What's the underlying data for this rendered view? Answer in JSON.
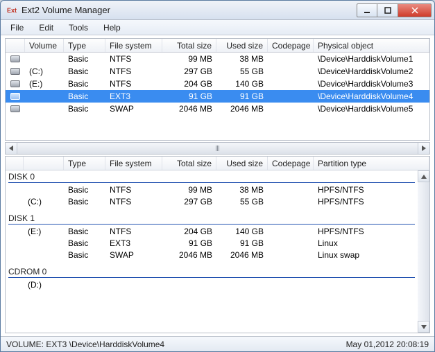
{
  "window": {
    "title": "Ext2 Volume Manager",
    "icon_label": "Ext"
  },
  "menu": {
    "file": "File",
    "edit": "Edit",
    "tools": "Tools",
    "help": "Help"
  },
  "columns_top": {
    "volume": "Volume",
    "type": "Type",
    "fs": "File system",
    "total": "Total size",
    "used": "Used size",
    "codepage": "Codepage",
    "physical": "Physical object"
  },
  "volumes": [
    {
      "vol": "",
      "type": "Basic",
      "fs": "NTFS",
      "total": "99 MB",
      "used": "38 MB",
      "cp": "",
      "phys": "\\Device\\HarddiskVolume1",
      "sel": false
    },
    {
      "vol": "(C:)",
      "type": "Basic",
      "fs": "NTFS",
      "total": "297 GB",
      "used": "55 GB",
      "cp": "",
      "phys": "\\Device\\HarddiskVolume2",
      "sel": false
    },
    {
      "vol": "(E:)",
      "type": "Basic",
      "fs": "NTFS",
      "total": "204 GB",
      "used": "140 GB",
      "cp": "",
      "phys": "\\Device\\HarddiskVolume3",
      "sel": false
    },
    {
      "vol": "",
      "type": "Basic",
      "fs": "EXT3",
      "total": "91 GB",
      "used": "91 GB",
      "cp": "",
      "phys": "\\Device\\HarddiskVolume4",
      "sel": true
    },
    {
      "vol": "",
      "type": "Basic",
      "fs": "SWAP",
      "total": "2046 MB",
      "used": "2046 MB",
      "cp": "",
      "phys": "\\Device\\HarddiskVolume5",
      "sel": false
    }
  ],
  "columns_bottom": {
    "type": "Type",
    "fs": "File system",
    "total": "Total size",
    "used": "Used size",
    "codepage": "Codepage",
    "partition": "Partition type"
  },
  "groups": [
    {
      "name": "DISK 0",
      "rows": [
        {
          "vol": "",
          "type": "Basic",
          "fs": "NTFS",
          "total": "99 MB",
          "used": "38 MB",
          "cp": "",
          "part": "HPFS/NTFS"
        },
        {
          "vol": "(C:)",
          "type": "Basic",
          "fs": "NTFS",
          "total": "297 GB",
          "used": "55 GB",
          "cp": "",
          "part": "HPFS/NTFS"
        }
      ]
    },
    {
      "name": "DISK 1",
      "rows": [
        {
          "vol": "(E:)",
          "type": "Basic",
          "fs": "NTFS",
          "total": "204 GB",
          "used": "140 GB",
          "cp": "",
          "part": "HPFS/NTFS"
        },
        {
          "vol": "",
          "type": "Basic",
          "fs": "EXT3",
          "total": "91 GB",
          "used": "91 GB",
          "cp": "",
          "part": "Linux"
        },
        {
          "vol": "",
          "type": "Basic",
          "fs": "SWAP",
          "total": "2046 MB",
          "used": "2046 MB",
          "cp": "",
          "part": "Linux swap"
        }
      ]
    },
    {
      "name": "CDROM 0",
      "rows": [
        {
          "vol": "(D:)",
          "type": "",
          "fs": "",
          "total": "",
          "used": "",
          "cp": "",
          "part": ""
        }
      ]
    }
  ],
  "status": {
    "left": "VOLUME:  EXT3 \\Device\\HarddiskVolume4",
    "right": "May 01,2012 20:08:19"
  }
}
